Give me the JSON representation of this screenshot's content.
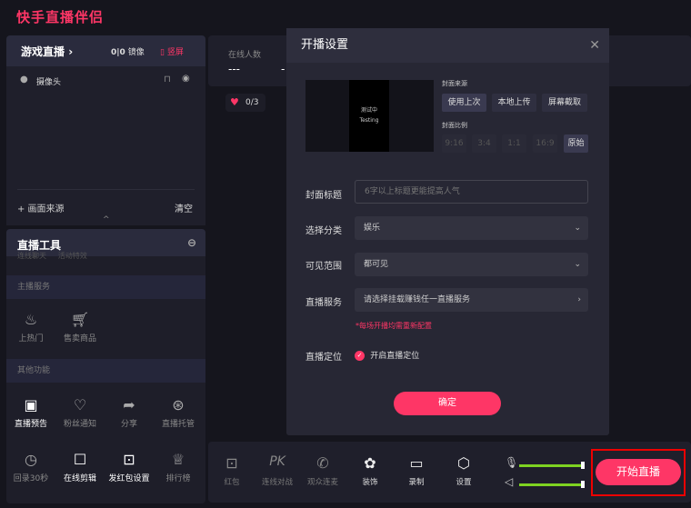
{
  "app_title": "快手直播伴侣",
  "source_panel": {
    "mode": "游戏直播",
    "mirror_label": "镜像",
    "portrait_label": "竖屏",
    "sources": [
      {
        "name": "摄像头"
      }
    ],
    "add_source": "+ 画面来源",
    "clear": "清空"
  },
  "tools": {
    "title": "直播工具",
    "partial_row": [
      "连线聊天",
      "活动特效"
    ],
    "sections": [
      {
        "title": "主播服务",
        "items": [
          {
            "label": "上热门",
            "icon": "fire-plus-icon"
          },
          {
            "label": "售卖商品",
            "icon": "cart-icon"
          }
        ]
      },
      {
        "title": "其他功能",
        "items": [
          {
            "label": "直播预告",
            "icon": "calendar-play-icon",
            "active": true
          },
          {
            "label": "粉丝通知",
            "icon": "heart-bubble-icon"
          },
          {
            "label": "分享",
            "icon": "share-icon"
          },
          {
            "label": "直播托管",
            "icon": "host-icon"
          },
          {
            "label": "回录30秒",
            "icon": "replay-icon"
          },
          {
            "label": "在线剪辑",
            "icon": "edit-icon",
            "active": true
          },
          {
            "label": "发红包设置",
            "icon": "redpacket-settings-icon",
            "active": true
          },
          {
            "label": "排行榜",
            "icon": "trophy-icon"
          }
        ]
      }
    ]
  },
  "stats": {
    "online_label": "在线人数",
    "online_value": "---",
    "second_value": "-",
    "heart_count": "0/3"
  },
  "modal": {
    "title": "开播设置",
    "preview_text": "测试中",
    "preview_text2": "Testing",
    "cover_source_label": "封面来源",
    "cover_sources": [
      "使用上次",
      "本地上传",
      "屏幕截取"
    ],
    "cover_ratio_label": "封面比例",
    "ratios": [
      "9:16",
      "3:4",
      "1:1",
      "16:9",
      "原始"
    ],
    "selected_ratio": "原始",
    "title_label": "封面标题",
    "title_placeholder": "6字以上标题更能提高人气",
    "category_label": "选择分类",
    "category_value": "娱乐",
    "visibility_label": "可见范围",
    "visibility_value": "都可见",
    "service_label": "直播服务",
    "service_value": "请选择挂载赚钱任一直播服务",
    "service_note": "*每场开播均需重新配置",
    "location_label": "直播定位",
    "location_option": "开启直播定位",
    "location_checked": true,
    "confirm": "确定"
  },
  "bottom": {
    "items": [
      {
        "label": "红包",
        "icon": "redpacket-icon"
      },
      {
        "label": "连线对战",
        "icon": "pk-icon"
      },
      {
        "label": "观众连麦",
        "icon": "phone-video-icon"
      },
      {
        "label": "装饰",
        "icon": "decoration-icon",
        "active": true
      },
      {
        "label": "录制",
        "icon": "record-icon",
        "active": true
      },
      {
        "label": "设置",
        "icon": "settings-icon",
        "active": true
      }
    ],
    "mic_level": 1.0,
    "speaker_level": 1.0,
    "start_button": "开始直播"
  },
  "colors": {
    "accent": "#fe3666",
    "volume": "#7ed321"
  }
}
